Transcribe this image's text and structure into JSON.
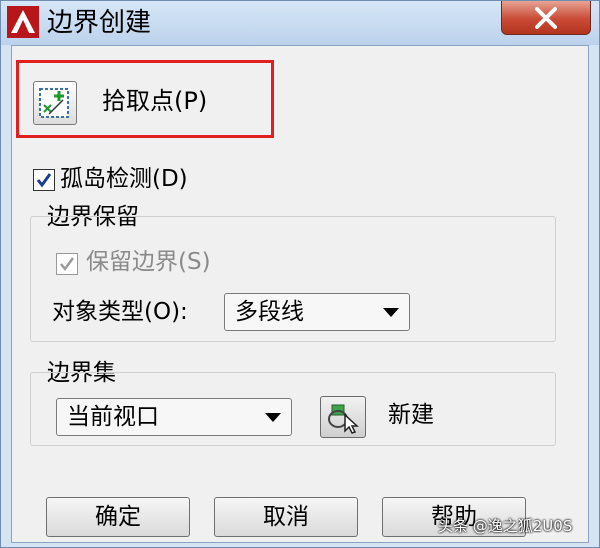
{
  "window": {
    "title": "边界创建",
    "icon": "autocad-a-icon",
    "close_icon": "close-icon"
  },
  "pick_points": {
    "label": "拾取点(P)",
    "icon": "pick-points-icon"
  },
  "island_detection": {
    "label": "孤岛检测(D)",
    "checked": true
  },
  "boundary_retention": {
    "group_label": "边界保留",
    "retain_boundaries": {
      "label": "保留边界(S)",
      "checked": true,
      "disabled": true
    },
    "object_type": {
      "label": "对象类型(O):",
      "selected": "多段线"
    }
  },
  "boundary_set": {
    "group_label": "边界集",
    "selected": "当前视口",
    "new_button_icon": "select-objects-icon",
    "new_label": "新建"
  },
  "buttons": {
    "ok": "确定",
    "cancel": "取消",
    "help": "帮助"
  },
  "watermark": "头条 @逸之狐2U0S",
  "colors": {
    "highlight": "#e02020",
    "close_button": "#c94a35"
  }
}
